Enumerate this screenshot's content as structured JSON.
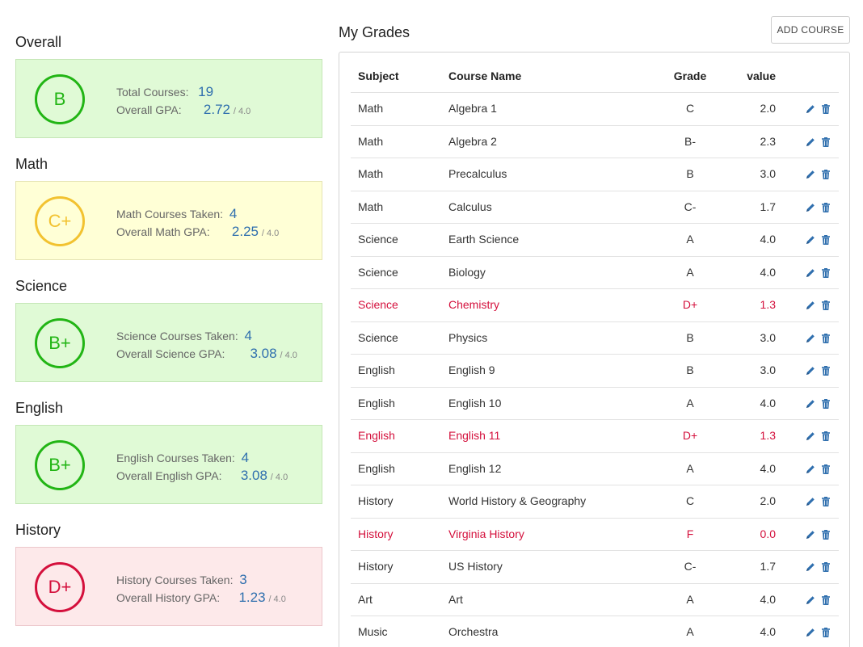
{
  "summaries": [
    {
      "title": "Overall",
      "grade": "B",
      "theme": "green",
      "count_label": "Total Courses:",
      "count": "19",
      "gpa_label": "Overall GPA:",
      "gpa": "2.72",
      "gpa_scale": "/ 4.0"
    },
    {
      "title": "Math",
      "grade": "C+",
      "theme": "yellow",
      "count_label": "Math Courses Taken:",
      "count": "4",
      "gpa_label": "Overall Math GPA:",
      "gpa": "2.25",
      "gpa_scale": "/ 4.0"
    },
    {
      "title": "Science",
      "grade": "B+",
      "theme": "green",
      "count_label": "Science Courses Taken:",
      "count": "4",
      "gpa_label": "Overall Science GPA:",
      "gpa": "3.08",
      "gpa_scale": "/ 4.0"
    },
    {
      "title": "English",
      "grade": "B+",
      "theme": "green",
      "count_label": "English Courses Taken:",
      "count": "4",
      "gpa_label": "Overall English GPA:",
      "gpa": "3.08",
      "gpa_scale": "/ 4.0"
    },
    {
      "title": "History",
      "grade": "D+",
      "theme": "red",
      "count_label": "History Courses Taken:",
      "count": "3",
      "gpa_label": "Overall History GPA:",
      "gpa": "1.23",
      "gpa_scale": "/ 4.0"
    }
  ],
  "grades": {
    "title": "My Grades",
    "add_label": "ADD COURSE",
    "headers": {
      "subject": "Subject",
      "course": "Course Name",
      "grade": "Grade",
      "value": "value"
    },
    "rows": [
      {
        "subject": "Math",
        "course": "Algebra 1",
        "grade": "C",
        "value": "2.0",
        "flag": false
      },
      {
        "subject": "Math",
        "course": "Algebra 2",
        "grade": "B-",
        "value": "2.3",
        "flag": false
      },
      {
        "subject": "Math",
        "course": "Precalculus",
        "grade": "B",
        "value": "3.0",
        "flag": false
      },
      {
        "subject": "Math",
        "course": "Calculus",
        "grade": "C-",
        "value": "1.7",
        "flag": false
      },
      {
        "subject": "Science",
        "course": "Earth Science",
        "grade": "A",
        "value": "4.0",
        "flag": false
      },
      {
        "subject": "Science",
        "course": "Biology",
        "grade": "A",
        "value": "4.0",
        "flag": false
      },
      {
        "subject": "Science",
        "course": "Chemistry",
        "grade": "D+",
        "value": "1.3",
        "flag": true
      },
      {
        "subject": "Science",
        "course": "Physics",
        "grade": "B",
        "value": "3.0",
        "flag": false
      },
      {
        "subject": "English",
        "course": "English 9",
        "grade": "B",
        "value": "3.0",
        "flag": false
      },
      {
        "subject": "English",
        "course": "English 10",
        "grade": "A",
        "value": "4.0",
        "flag": false
      },
      {
        "subject": "English",
        "course": "English 11",
        "grade": "D+",
        "value": "1.3",
        "flag": true
      },
      {
        "subject": "English",
        "course": "English 12",
        "grade": "A",
        "value": "4.0",
        "flag": false
      },
      {
        "subject": "History",
        "course": "World History & Geography",
        "grade": "C",
        "value": "2.0",
        "flag": false
      },
      {
        "subject": "History",
        "course": "Virginia History",
        "grade": "F",
        "value": "0.0",
        "flag": true
      },
      {
        "subject": "History",
        "course": "US History",
        "grade": "C-",
        "value": "1.7",
        "flag": false
      },
      {
        "subject": "Art",
        "course": "Art",
        "grade": "A",
        "value": "4.0",
        "flag": false
      },
      {
        "subject": "Music",
        "course": "Orchestra",
        "grade": "A",
        "value": "4.0",
        "flag": false
      }
    ]
  },
  "colors": {
    "accent": "#2f6fae",
    "good": "#22b515",
    "warn": "#f2c230",
    "bad": "#d4103c"
  },
  "icons": {
    "edit": "pencil-icon",
    "delete": "trash-icon"
  }
}
